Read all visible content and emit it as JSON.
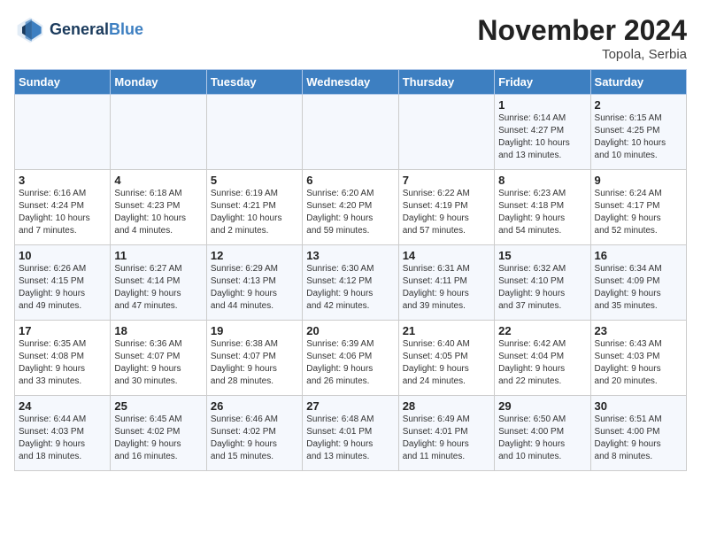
{
  "header": {
    "logo_line1": "General",
    "logo_line2": "Blue",
    "month_title": "November 2024",
    "location": "Topola, Serbia"
  },
  "weekdays": [
    "Sunday",
    "Monday",
    "Tuesday",
    "Wednesday",
    "Thursday",
    "Friday",
    "Saturday"
  ],
  "weeks": [
    [
      {
        "day": "",
        "info": ""
      },
      {
        "day": "",
        "info": ""
      },
      {
        "day": "",
        "info": ""
      },
      {
        "day": "",
        "info": ""
      },
      {
        "day": "",
        "info": ""
      },
      {
        "day": "1",
        "info": "Sunrise: 6:14 AM\nSunset: 4:27 PM\nDaylight: 10 hours\nand 13 minutes."
      },
      {
        "day": "2",
        "info": "Sunrise: 6:15 AM\nSunset: 4:25 PM\nDaylight: 10 hours\nand 10 minutes."
      }
    ],
    [
      {
        "day": "3",
        "info": "Sunrise: 6:16 AM\nSunset: 4:24 PM\nDaylight: 10 hours\nand 7 minutes."
      },
      {
        "day": "4",
        "info": "Sunrise: 6:18 AM\nSunset: 4:23 PM\nDaylight: 10 hours\nand 4 minutes."
      },
      {
        "day": "5",
        "info": "Sunrise: 6:19 AM\nSunset: 4:21 PM\nDaylight: 10 hours\nand 2 minutes."
      },
      {
        "day": "6",
        "info": "Sunrise: 6:20 AM\nSunset: 4:20 PM\nDaylight: 9 hours\nand 59 minutes."
      },
      {
        "day": "7",
        "info": "Sunrise: 6:22 AM\nSunset: 4:19 PM\nDaylight: 9 hours\nand 57 minutes."
      },
      {
        "day": "8",
        "info": "Sunrise: 6:23 AM\nSunset: 4:18 PM\nDaylight: 9 hours\nand 54 minutes."
      },
      {
        "day": "9",
        "info": "Sunrise: 6:24 AM\nSunset: 4:17 PM\nDaylight: 9 hours\nand 52 minutes."
      }
    ],
    [
      {
        "day": "10",
        "info": "Sunrise: 6:26 AM\nSunset: 4:15 PM\nDaylight: 9 hours\nand 49 minutes."
      },
      {
        "day": "11",
        "info": "Sunrise: 6:27 AM\nSunset: 4:14 PM\nDaylight: 9 hours\nand 47 minutes."
      },
      {
        "day": "12",
        "info": "Sunrise: 6:29 AM\nSunset: 4:13 PM\nDaylight: 9 hours\nand 44 minutes."
      },
      {
        "day": "13",
        "info": "Sunrise: 6:30 AM\nSunset: 4:12 PM\nDaylight: 9 hours\nand 42 minutes."
      },
      {
        "day": "14",
        "info": "Sunrise: 6:31 AM\nSunset: 4:11 PM\nDaylight: 9 hours\nand 39 minutes."
      },
      {
        "day": "15",
        "info": "Sunrise: 6:32 AM\nSunset: 4:10 PM\nDaylight: 9 hours\nand 37 minutes."
      },
      {
        "day": "16",
        "info": "Sunrise: 6:34 AM\nSunset: 4:09 PM\nDaylight: 9 hours\nand 35 minutes."
      }
    ],
    [
      {
        "day": "17",
        "info": "Sunrise: 6:35 AM\nSunset: 4:08 PM\nDaylight: 9 hours\nand 33 minutes."
      },
      {
        "day": "18",
        "info": "Sunrise: 6:36 AM\nSunset: 4:07 PM\nDaylight: 9 hours\nand 30 minutes."
      },
      {
        "day": "19",
        "info": "Sunrise: 6:38 AM\nSunset: 4:07 PM\nDaylight: 9 hours\nand 28 minutes."
      },
      {
        "day": "20",
        "info": "Sunrise: 6:39 AM\nSunset: 4:06 PM\nDaylight: 9 hours\nand 26 minutes."
      },
      {
        "day": "21",
        "info": "Sunrise: 6:40 AM\nSunset: 4:05 PM\nDaylight: 9 hours\nand 24 minutes."
      },
      {
        "day": "22",
        "info": "Sunrise: 6:42 AM\nSunset: 4:04 PM\nDaylight: 9 hours\nand 22 minutes."
      },
      {
        "day": "23",
        "info": "Sunrise: 6:43 AM\nSunset: 4:03 PM\nDaylight: 9 hours\nand 20 minutes."
      }
    ],
    [
      {
        "day": "24",
        "info": "Sunrise: 6:44 AM\nSunset: 4:03 PM\nDaylight: 9 hours\nand 18 minutes."
      },
      {
        "day": "25",
        "info": "Sunrise: 6:45 AM\nSunset: 4:02 PM\nDaylight: 9 hours\nand 16 minutes."
      },
      {
        "day": "26",
        "info": "Sunrise: 6:46 AM\nSunset: 4:02 PM\nDaylight: 9 hours\nand 15 minutes."
      },
      {
        "day": "27",
        "info": "Sunrise: 6:48 AM\nSunset: 4:01 PM\nDaylight: 9 hours\nand 13 minutes."
      },
      {
        "day": "28",
        "info": "Sunrise: 6:49 AM\nSunset: 4:01 PM\nDaylight: 9 hours\nand 11 minutes."
      },
      {
        "day": "29",
        "info": "Sunrise: 6:50 AM\nSunset: 4:00 PM\nDaylight: 9 hours\nand 10 minutes."
      },
      {
        "day": "30",
        "info": "Sunrise: 6:51 AM\nSunset: 4:00 PM\nDaylight: 9 hours\nand 8 minutes."
      }
    ]
  ]
}
